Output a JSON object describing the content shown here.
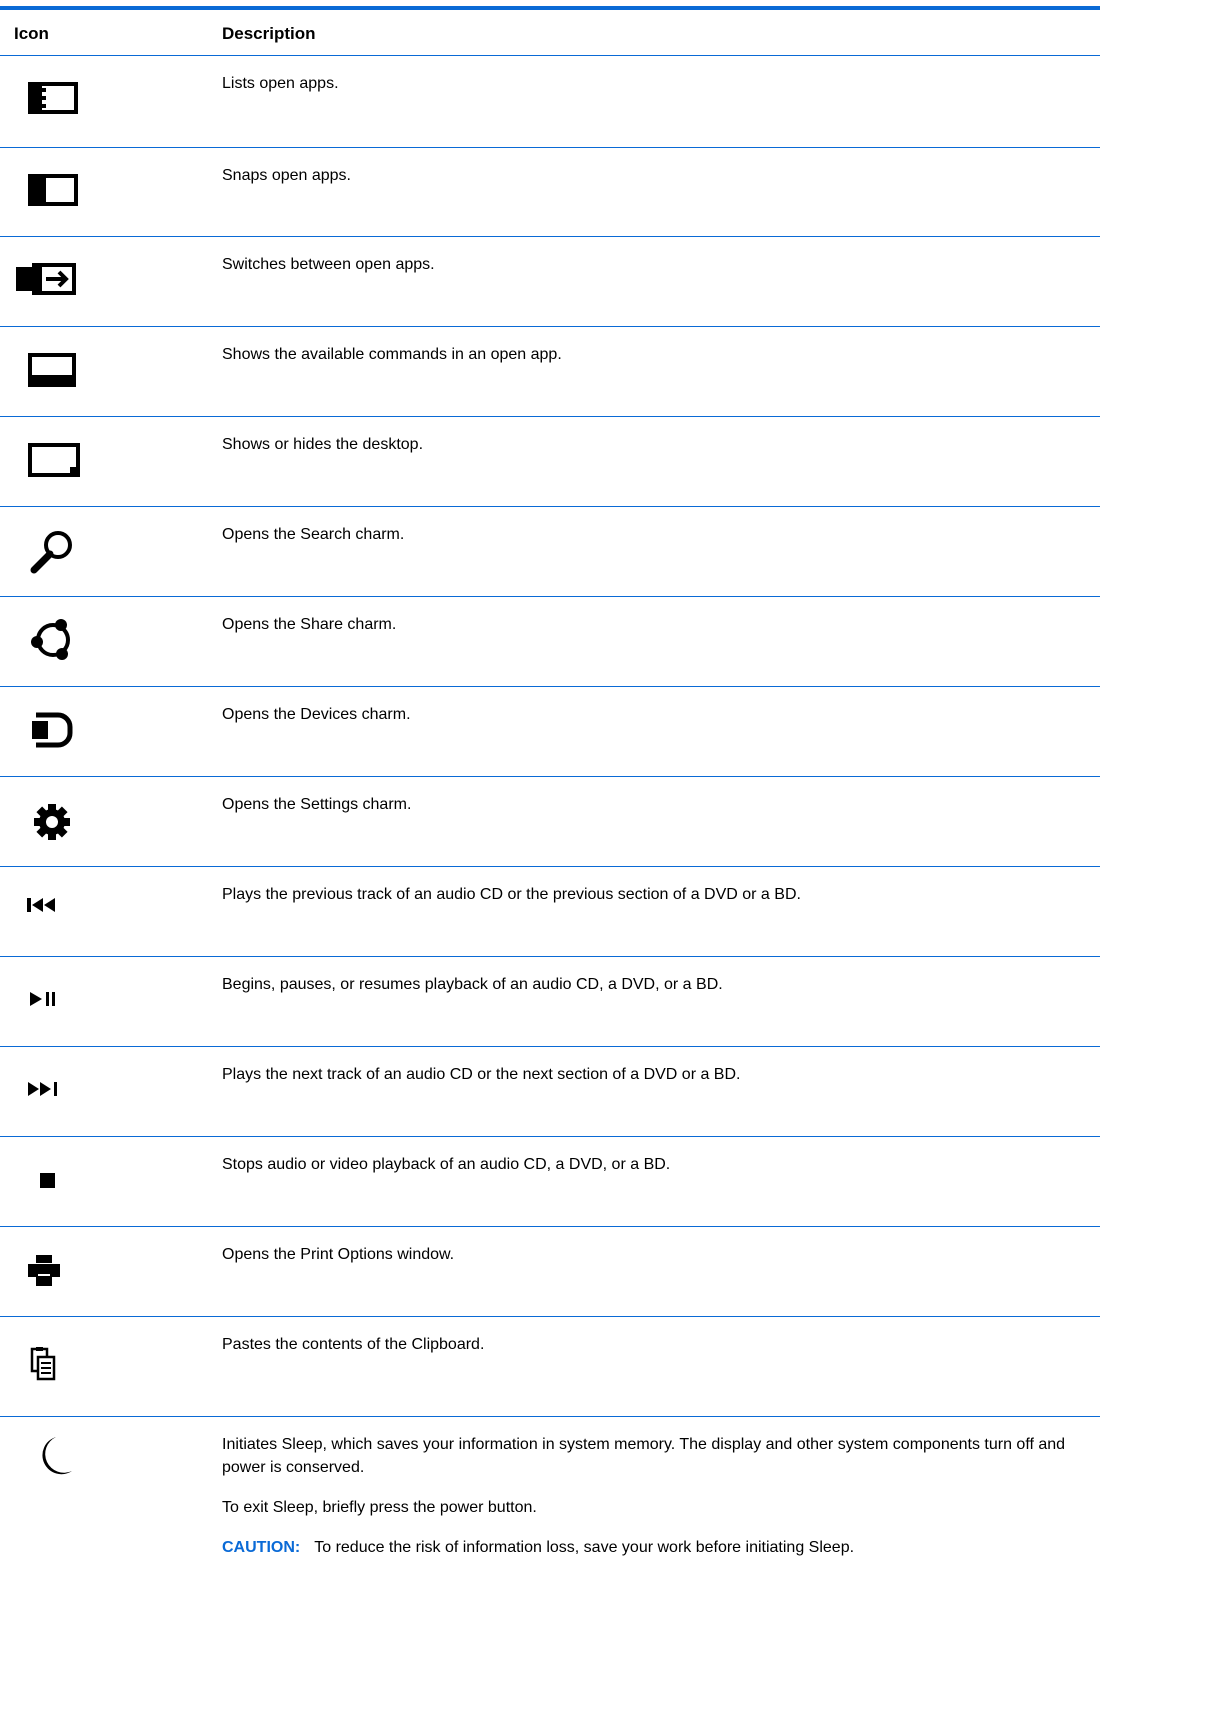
{
  "header": {
    "icon": "Icon",
    "description": "Description"
  },
  "colors": {
    "accent": "#0a6ad6"
  },
  "rows": [
    {
      "icon": "app-list-icon",
      "description": "Lists open apps."
    },
    {
      "icon": "snap-icon",
      "description": "Snaps open apps."
    },
    {
      "icon": "switch-apps-icon",
      "description": "Switches between open apps."
    },
    {
      "icon": "app-commands-icon",
      "description": "Shows the available commands in an open app."
    },
    {
      "icon": "show-desktop-icon",
      "description": "Shows or hides the desktop."
    },
    {
      "icon": "search-icon",
      "description": "Opens the Search charm."
    },
    {
      "icon": "share-icon",
      "description": "Opens the Share charm."
    },
    {
      "icon": "devices-icon",
      "description": "Opens the Devices charm."
    },
    {
      "icon": "settings-gear-icon",
      "description": "Opens the Settings charm."
    },
    {
      "icon": "previous-track-icon",
      "description": "Plays the previous track of an audio CD or the previous section of a DVD or a BD."
    },
    {
      "icon": "play-pause-icon",
      "description": "Begins, pauses, or resumes playback of an audio CD, a DVD, or a BD."
    },
    {
      "icon": "next-track-icon",
      "description": "Plays the next track of an audio CD or the next section of a DVD or a BD."
    },
    {
      "icon": "stop-icon",
      "description": "Stops audio or video playback of an audio CD, a DVD, or a BD."
    },
    {
      "icon": "printer-icon",
      "description": "Opens the Print Options window."
    },
    {
      "icon": "clipboard-paste-icon",
      "description": "Pastes the contents of the Clipboard."
    },
    {
      "icon": "sleep-moon-icon",
      "description": "Initiates Sleep, which saves your information in system memory. The display and other system components turn off and power is conserved.",
      "extra": "To exit Sleep, briefly press the power button.",
      "caution_label": "CAUTION:",
      "caution_text": "To reduce the risk of information loss, save your work before initiating Sleep."
    }
  ]
}
